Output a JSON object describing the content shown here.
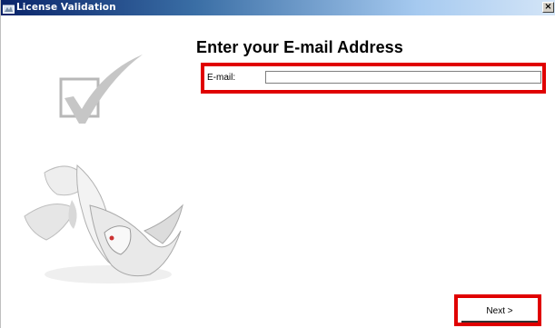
{
  "window": {
    "title": "License Validation",
    "close_label": "×"
  },
  "main": {
    "heading": "Enter your E-mail Address"
  },
  "email": {
    "label": "E-mail:",
    "value": "",
    "placeholder": ""
  },
  "footer": {
    "next_label": "Next >"
  },
  "colors": {
    "highlight": "#e00000",
    "titlebar_start": "#0a246a",
    "titlebar_end": "#d4e5f7"
  },
  "icons": [
    "app-icon",
    "checkmark-icon",
    "rhino-logo-icon"
  ]
}
